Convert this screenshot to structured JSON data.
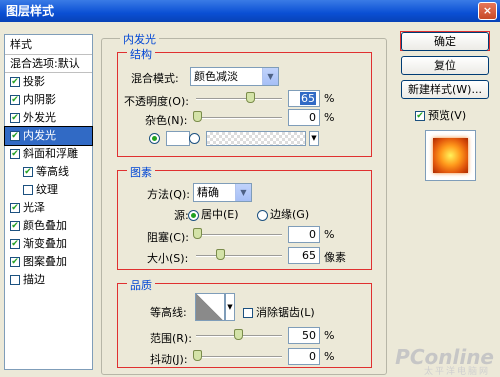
{
  "window": {
    "title": "图层样式",
    "close": "×"
  },
  "styles": {
    "header": "样式",
    "items": [
      {
        "label": "混合选项:默认",
        "checked": null
      },
      {
        "label": "投影",
        "checked": true
      },
      {
        "label": "内阴影",
        "checked": true
      },
      {
        "label": "外发光",
        "checked": true
      },
      {
        "label": "内发光",
        "checked": true,
        "selected": true
      },
      {
        "label": "斜面和浮雕",
        "checked": true
      },
      {
        "label": "等高线",
        "checked": true,
        "sub": true
      },
      {
        "label": "纹理",
        "checked": false,
        "sub": true
      },
      {
        "label": "光泽",
        "checked": true
      },
      {
        "label": "颜色叠加",
        "checked": true
      },
      {
        "label": "渐变叠加",
        "checked": true
      },
      {
        "label": "图案叠加",
        "checked": true
      },
      {
        "label": "描边",
        "checked": false
      }
    ]
  },
  "panel": {
    "title": "内发光",
    "structure": {
      "title": "结构",
      "blend_mode_label": "混合模式:",
      "blend_mode": "颜色减淡",
      "opacity_label": "不透明度(O):",
      "opacity": "65",
      "noise_label": "杂色(N):",
      "noise": "0",
      "percent": "%"
    },
    "elements": {
      "title": "图素",
      "method_label": "方法(Q):",
      "method": "精确",
      "source_label": "源:",
      "center_label": "居中(E)",
      "edge_label": "边缘(G)",
      "choke_label": "阻塞(C):",
      "choke": "0",
      "size_label": "大小(S):",
      "size": "65",
      "percent": "%",
      "px": "像素"
    },
    "quality": {
      "title": "品质",
      "contour_label": "等高线:",
      "antialias_label": "消除锯齿(L)",
      "range_label": "范围(R):",
      "range": "50",
      "jitter_label": "抖动(J):",
      "jitter": "0",
      "percent": "%"
    }
  },
  "buttons": {
    "ok": "确定",
    "reset": "复位",
    "new_style": "新建样式(W)...",
    "preview_label": "预览(V)"
  },
  "watermark": {
    "brand": "PConline",
    "tag": "太平洋电脑网"
  },
  "colors": {
    "accent": "#316AC5",
    "highlight": "#E03030",
    "group_title": "#0046D5"
  }
}
